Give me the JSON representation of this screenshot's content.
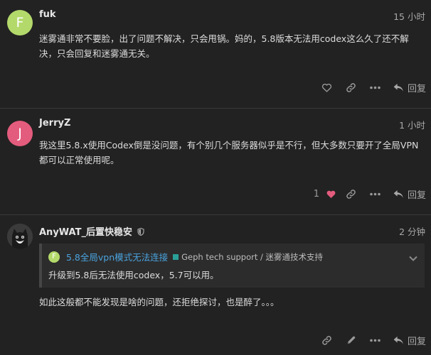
{
  "posts": [
    {
      "avatar_letter": "F",
      "username": "fuk",
      "time": "15 小时",
      "body": "迷雾通非常不要脸，出了问题不解决，只会甩锅。妈的，5.8版本无法用codex这么久了还不解决，只会回复和迷雾通无关。",
      "reply_label": "回复"
    },
    {
      "avatar_letter": "J",
      "username": "JerryZ",
      "time": "1 小时",
      "body": "我这里5.8.x使用Codex倒是没问题，有个别几个服务器似乎是不行，但大多数只要开了全局VPN都可以正常使用呢。",
      "like_count": "1",
      "reply_label": "回复"
    },
    {
      "username": "AnyWAT_后置快稳安",
      "time": "2 分钟",
      "quote": {
        "avatar_letter": "F",
        "title": "5.8全局vpn模式无法连接",
        "category": "Geph tech support / 迷雾通技术支持",
        "text": "升级到5.8后无法使用codex，5.7可以用。"
      },
      "body": "如此这般都不能发现是啥的问题，还拒绝探讨，也是醉了。。。",
      "reply_label": "回复"
    }
  ],
  "colors": {
    "background": "#222222",
    "avatar_fuk": "#b3d96b",
    "avatar_jerryz": "#e45c7d",
    "link": "#4aa3df",
    "category": "#2aa198",
    "heart": "#e45c7d"
  },
  "icons": [
    "heart-icon",
    "link-icon",
    "more-icon",
    "reply-icon",
    "pencil-icon",
    "shield-icon",
    "chevron-down-icon"
  ]
}
